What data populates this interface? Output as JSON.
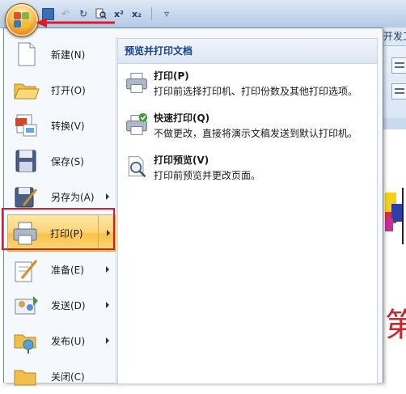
{
  "toolbar": {
    "quick_access": [
      {
        "icon": "save-icon",
        "label": ""
      },
      {
        "icon": "undo-icon",
        "label": "↶"
      },
      {
        "icon": "redo-icon",
        "label": "↻"
      },
      {
        "icon": "print-preview-icon",
        "label": "🔍"
      },
      {
        "icon": "superscript-icon",
        "label": "x²"
      },
      {
        "icon": "subscript-icon",
        "label": "x₂"
      },
      {
        "icon": "customize-icon",
        "label": "▿"
      }
    ]
  },
  "ribbon": {
    "tab_label": "开发工"
  },
  "menu": {
    "items": [
      {
        "label": "新建(N)",
        "icon": "new-document-icon",
        "has_submenu": false
      },
      {
        "label": "打开(O)",
        "icon": "open-folder-icon",
        "has_submenu": false
      },
      {
        "label": "转换(V)",
        "icon": "convert-icon",
        "has_submenu": false
      },
      {
        "label": "保存(S)",
        "icon": "save-icon",
        "has_submenu": false
      },
      {
        "label": "另存为(A)",
        "icon": "save-as-icon",
        "has_submenu": true
      },
      {
        "label": "打印(P)",
        "icon": "printer-icon",
        "has_submenu": true,
        "selected": true
      },
      {
        "label": "准备(E)",
        "icon": "prepare-icon",
        "has_submenu": true
      },
      {
        "label": "发送(D)",
        "icon": "send-icon",
        "has_submenu": true
      },
      {
        "label": "发布(U)",
        "icon": "publish-icon",
        "has_submenu": true
      },
      {
        "label": "关闭(C)",
        "icon": "close-folder-icon",
        "has_submenu": false
      }
    ],
    "submenu": {
      "header": "预览并打印文档",
      "items": [
        {
          "title": "打印(P)",
          "desc": "打印前选择打印机、打印份数及其他打印选项。",
          "icon": "printer-icon"
        },
        {
          "title": "快速打印(Q)",
          "desc": "不做更改，直接将演示文稿发送到默认打印机。",
          "icon": "quick-print-icon"
        },
        {
          "title": "打印预览(V)",
          "desc": "打印前预览并更改页面。",
          "icon": "print-preview-icon"
        }
      ]
    }
  },
  "document": {
    "visible_char": "第"
  },
  "colors": {
    "highlight": "#fcd679",
    "annotation_red": "#e01b24",
    "header_text": "#15428b"
  }
}
